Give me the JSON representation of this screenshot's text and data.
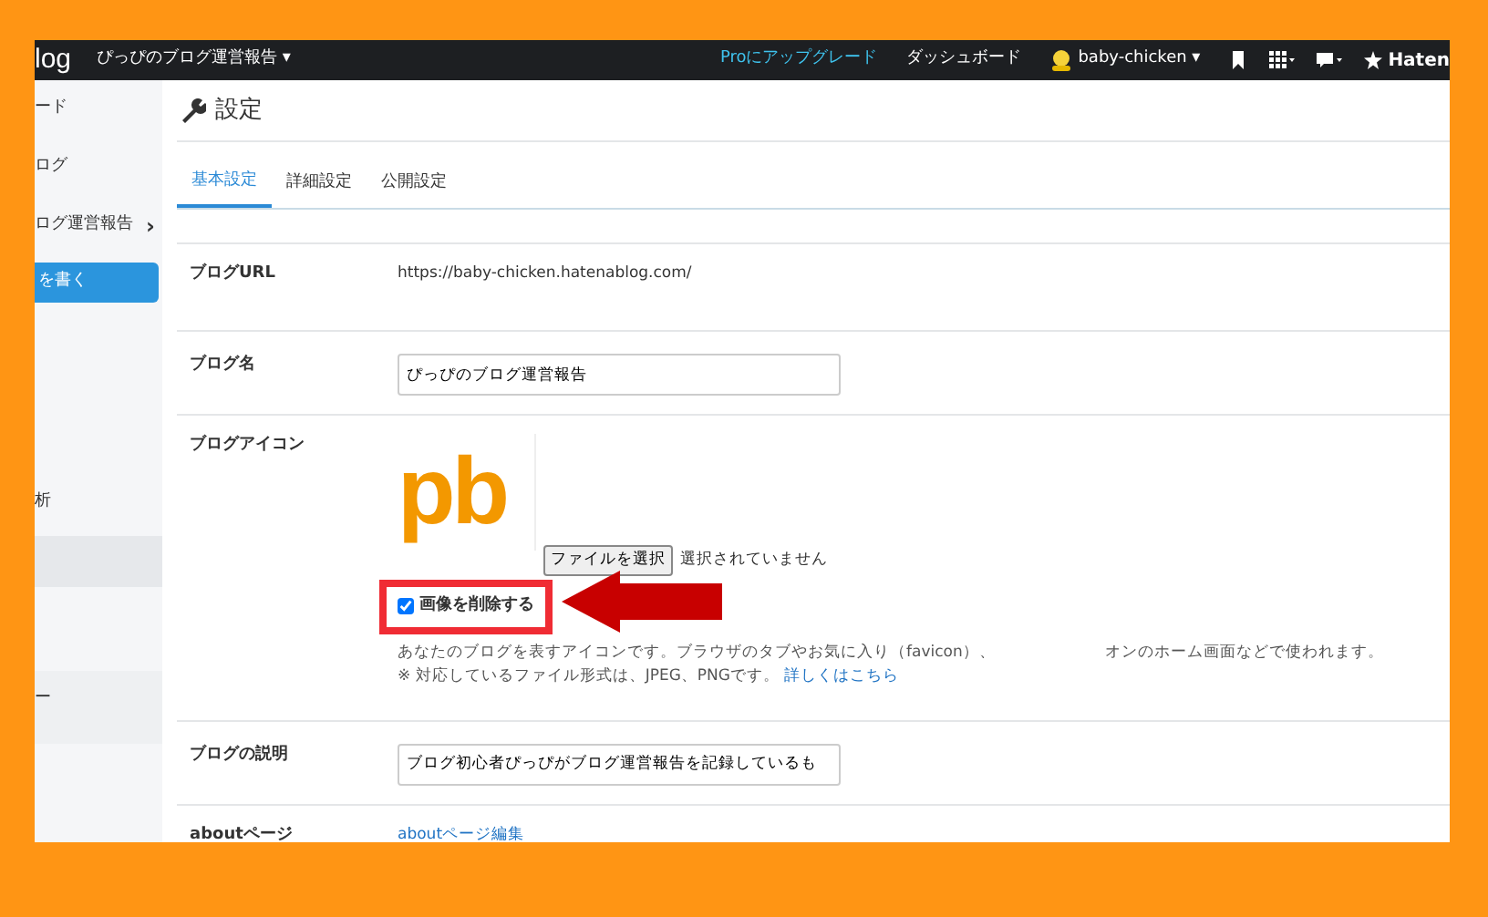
{
  "topbar": {
    "logo": "log",
    "blog_menu": "ぴっぴのブログ運営報告",
    "blog_menu_caret": "▾",
    "user_menu_caret": "▾",
    "upgrade_link": "Proにアップグレード",
    "dashboard_link": "ダッシュボード",
    "user_menu": "baby-chicken",
    "brand": "Haten"
  },
  "sidebar": {
    "top_items": [
      {
        "label": "ード",
        "kind": "link"
      },
      {
        "label": "ログ",
        "kind": "link"
      },
      {
        "label": "ログ運営報告",
        "kind": "expandable",
        "chevron": "›"
      },
      {
        "label": "を書く",
        "kind": "button"
      }
    ],
    "middle_items": [
      {
        "label": "析",
        "kind": "link"
      }
    ],
    "bottom_items": [
      {
        "label": "ー",
        "kind": "link"
      }
    ]
  },
  "page_title": "設定",
  "tabs": [
    {
      "label": "基本設定",
      "selected": true
    },
    {
      "label": "詳細設定",
      "selected": false
    },
    {
      "label": "公開設定",
      "selected": false
    }
  ],
  "settings": [
    {
      "label": "ブログURL",
      "kind": "text",
      "value": "https://baby-chicken.hatenablog.com/"
    },
    {
      "label": "ブログ名",
      "kind": "input",
      "value": "ぴっぴのブログ運営報告"
    },
    {
      "label": "ブログアイコン",
      "kind": "icon",
      "icon_text": "pb",
      "file_button": "ファイルを選択",
      "file_status": "選択されていません",
      "delete_checkbox": {
        "label": "画像を削除する",
        "checked": true
      },
      "help_line_1a": "あなたのブログを表すアイコンです。ブラウザのタブやお気に入り（favicon）、",
      "help_line_1b": "オンのホーム画面などで使われます。",
      "help_line_2": "※ 対応しているファイル形式は、JPEG、PNGです。",
      "help_link": "詳しくはこちら"
    },
    {
      "label": "ブログの説明",
      "kind": "input",
      "value": "ブログ初心者ぴっぴがブログ運営報告を記録しているも"
    },
    {
      "label": "aboutページ",
      "kind": "link",
      "value": "aboutページ編集"
    }
  ]
}
